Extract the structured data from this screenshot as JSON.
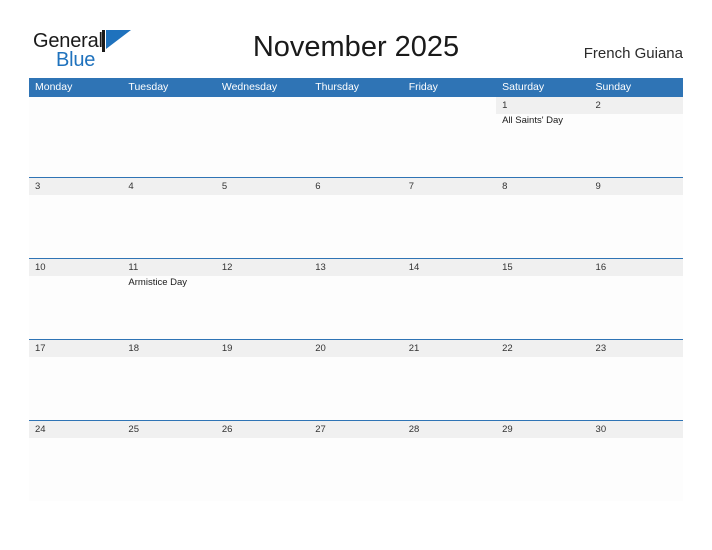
{
  "brand": {
    "name_part1": "General",
    "name_part2": "Blue",
    "flag_icon": "flag-triangle-icon",
    "accent_color": "#1f72bd"
  },
  "header": {
    "title": "November 2025",
    "region": "French Guiana"
  },
  "colors": {
    "header_blue": "#2f74b5",
    "row_band_gray": "#f0f0f0",
    "rule_blue": "#2f74b5",
    "text_dark": "#1a1a1a"
  },
  "calendar": {
    "weekdays": [
      "Monday",
      "Tuesday",
      "Wednesday",
      "Thursday",
      "Friday",
      "Saturday",
      "Sunday"
    ],
    "weeks": [
      {
        "days": [
          {
            "num": "",
            "event": ""
          },
          {
            "num": "",
            "event": ""
          },
          {
            "num": "",
            "event": ""
          },
          {
            "num": "",
            "event": ""
          },
          {
            "num": "",
            "event": ""
          },
          {
            "num": "1",
            "event": "All Saints' Day"
          },
          {
            "num": "2",
            "event": ""
          }
        ]
      },
      {
        "days": [
          {
            "num": "3",
            "event": ""
          },
          {
            "num": "4",
            "event": ""
          },
          {
            "num": "5",
            "event": ""
          },
          {
            "num": "6",
            "event": ""
          },
          {
            "num": "7",
            "event": ""
          },
          {
            "num": "8",
            "event": ""
          },
          {
            "num": "9",
            "event": ""
          }
        ]
      },
      {
        "days": [
          {
            "num": "10",
            "event": ""
          },
          {
            "num": "11",
            "event": "Armistice Day"
          },
          {
            "num": "12",
            "event": ""
          },
          {
            "num": "13",
            "event": ""
          },
          {
            "num": "14",
            "event": ""
          },
          {
            "num": "15",
            "event": ""
          },
          {
            "num": "16",
            "event": ""
          }
        ]
      },
      {
        "days": [
          {
            "num": "17",
            "event": ""
          },
          {
            "num": "18",
            "event": ""
          },
          {
            "num": "19",
            "event": ""
          },
          {
            "num": "20",
            "event": ""
          },
          {
            "num": "21",
            "event": ""
          },
          {
            "num": "22",
            "event": ""
          },
          {
            "num": "23",
            "event": ""
          }
        ]
      },
      {
        "days": [
          {
            "num": "24",
            "event": ""
          },
          {
            "num": "25",
            "event": ""
          },
          {
            "num": "26",
            "event": ""
          },
          {
            "num": "27",
            "event": ""
          },
          {
            "num": "28",
            "event": ""
          },
          {
            "num": "29",
            "event": ""
          },
          {
            "num": "30",
            "event": ""
          }
        ]
      }
    ]
  }
}
